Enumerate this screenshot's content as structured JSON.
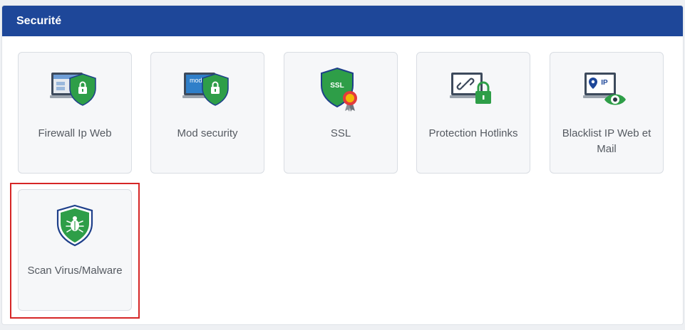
{
  "panel": {
    "title": "Securité"
  },
  "tiles": [
    {
      "label": "Firewall Ip Web",
      "icon": "firewall-icon"
    },
    {
      "label": "Mod security",
      "icon": "mod-security-icon",
      "icon_text": "mod"
    },
    {
      "label": "SSL",
      "icon": "ssl-icon",
      "icon_text": "SSL"
    },
    {
      "label": "Protection Hotlinks",
      "icon": "hotlink-protection-icon"
    },
    {
      "label": "Blacklist IP Web et Mail",
      "icon": "blacklist-ip-icon",
      "icon_text": "IP"
    },
    {
      "label": "Scan Virus/Malware",
      "icon": "virus-scan-icon"
    }
  ],
  "colors": {
    "header": "#1e4799",
    "shield_green": "#2e9e48",
    "shield_border": "#1e3f8a",
    "highlight": "#d62626"
  }
}
